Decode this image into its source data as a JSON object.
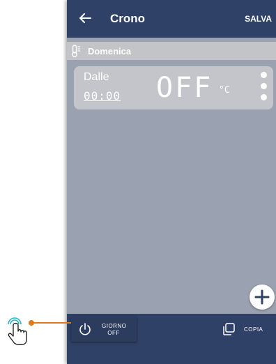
{
  "header": {
    "back_icon": "arrow-left-icon",
    "title": "Crono",
    "save_label": "SALVA"
  },
  "day_band": {
    "icon": "thermometer-icon",
    "label": "Domenica"
  },
  "schedule_row": {
    "from_label": "Dalle",
    "time": "00:00",
    "temperature": "OFF",
    "unit": "°C",
    "menu_icon": "more-vertical-icon"
  },
  "fab": {
    "icon": "plus-icon"
  },
  "bottom_bar": {
    "day_off_icon": "power-icon",
    "day_off_line1": "GIORNO",
    "day_off_line2": "OFF",
    "copy_icon": "copy-icon",
    "copy_label": "COPIA"
  },
  "annotation": {
    "hand_icon": "tap-hand-icon",
    "accent_color": "#e07a1f"
  },
  "colors": {
    "primary": "#2f4166",
    "background": "#9aa1b0",
    "card": "#c3c5ca"
  }
}
